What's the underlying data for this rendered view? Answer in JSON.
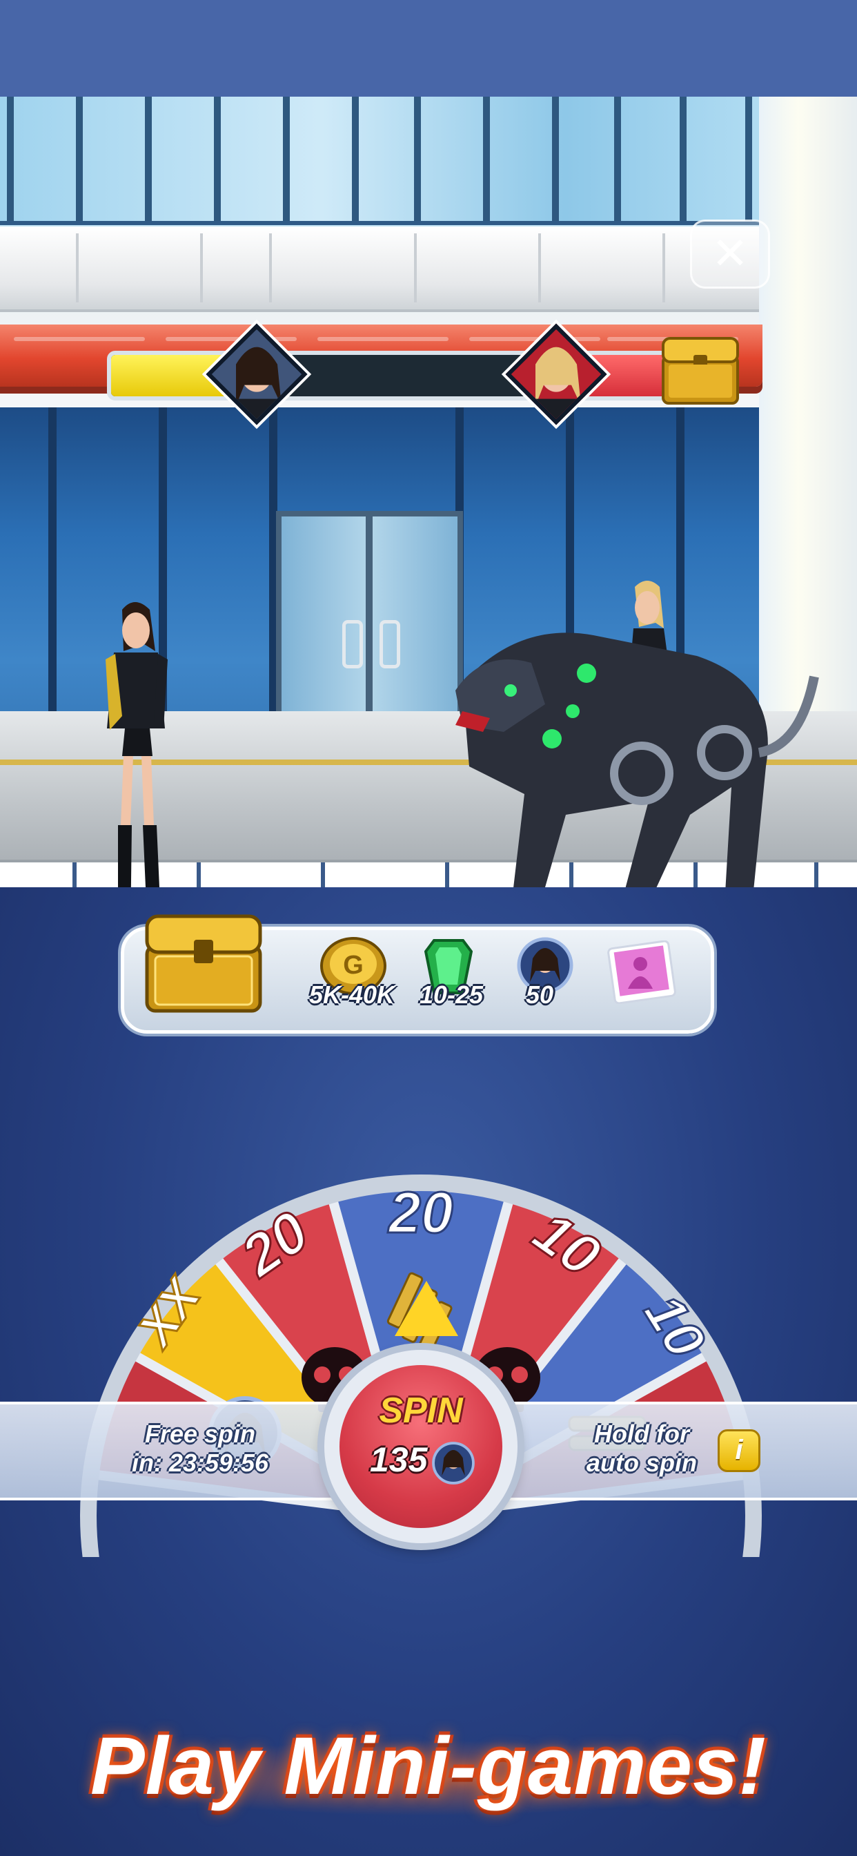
{
  "close_button": {
    "icon": "close-icon",
    "symbol": "✕"
  },
  "battle": {
    "player_health": 0.26,
    "enemy_health": 0.22
  },
  "rewards": {
    "items": [
      {
        "icon": "gold-coin-icon",
        "label": "5K-40K"
      },
      {
        "icon": "green-gem-icon",
        "label": "10-25"
      },
      {
        "icon": "character-token-icon",
        "label": "50"
      },
      {
        "icon": "character-card-icon",
        "label": ""
      }
    ]
  },
  "wheel": {
    "segments": [
      {
        "value": "XX",
        "reward": "character-token",
        "color": "#f5c21b"
      },
      {
        "value": "20",
        "reward": "skull",
        "color": "#d9434d"
      },
      {
        "value": "20",
        "reward": "bullets",
        "color": "#4d6fc4"
      },
      {
        "value": "10",
        "reward": "skull",
        "color": "#d9434d"
      },
      {
        "value": "10",
        "reward": "bullets",
        "color": "#4d6fc4"
      }
    ]
  },
  "spin": {
    "label": "SPIN",
    "cost": "135",
    "free_spin_line1": "Free spin",
    "free_spin_line2": "in: 23:59:56",
    "hold_line1": "Hold for",
    "hold_line2": "auto spin",
    "info_symbol": "i"
  },
  "headline": "Play Mini-games!",
  "colors": {
    "accent_yellow": "#ffd73a",
    "spin_red": "#d63a48",
    "panel_blue": "#263f80"
  }
}
